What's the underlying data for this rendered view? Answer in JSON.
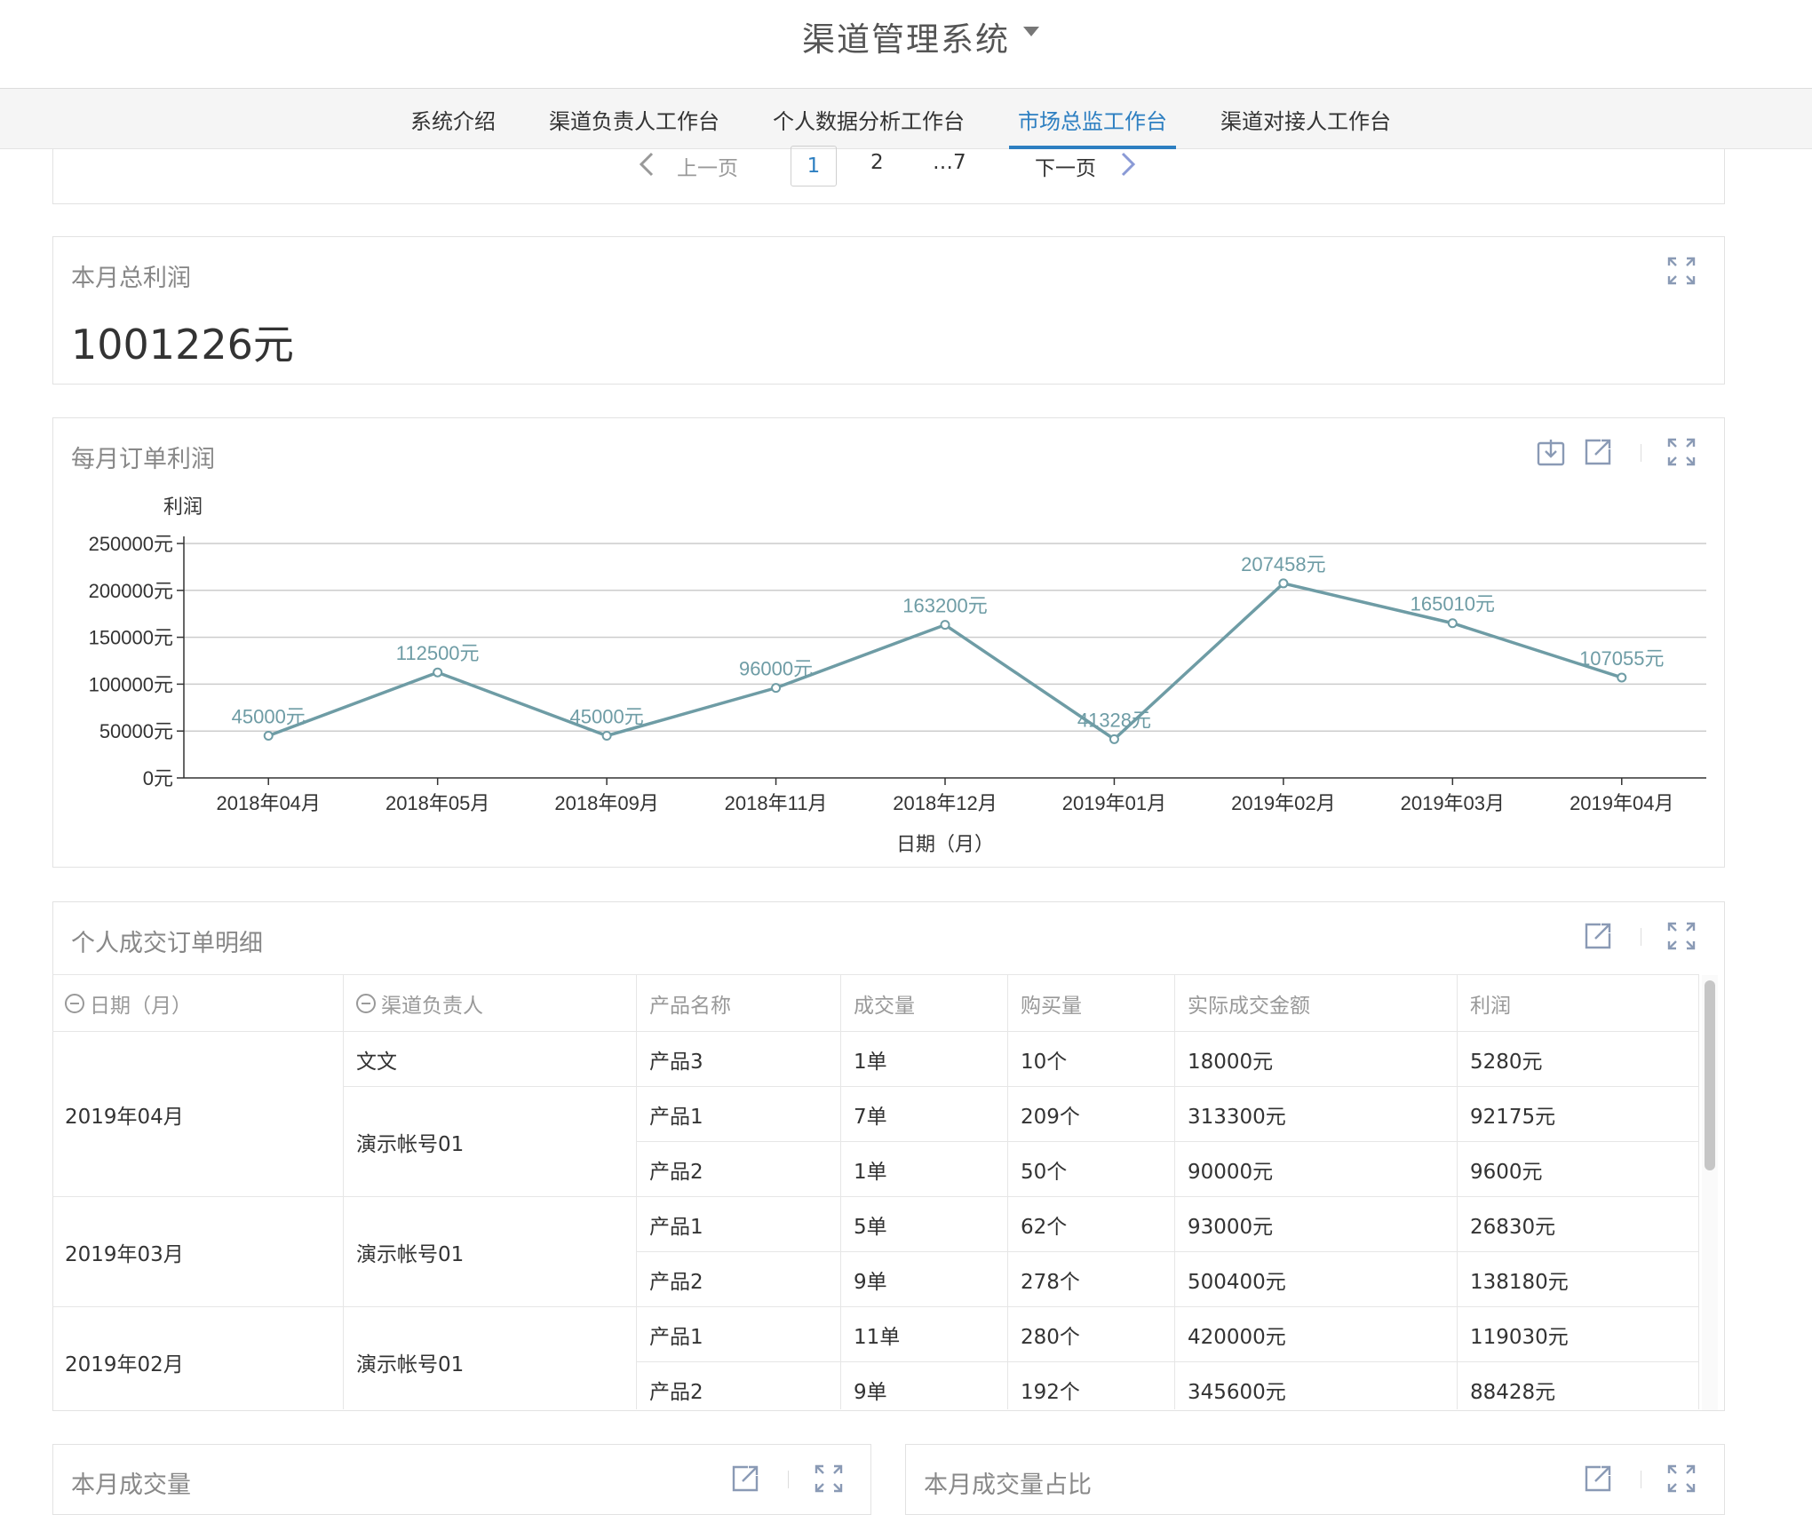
{
  "app": {
    "title": "渠道管理系统"
  },
  "nav": {
    "tabs": [
      {
        "label": "系统介绍"
      },
      {
        "label": "渠道负责人工作台"
      },
      {
        "label": "个人数据分析工作台"
      },
      {
        "label": "市场总监工作台"
      },
      {
        "label": "渠道对接人工作台"
      }
    ],
    "active": "市场总监工作台"
  },
  "pagination": {
    "prev": "上一页",
    "current": "1",
    "page2": "2",
    "ellipsis": "…7",
    "next": "下一页"
  },
  "profit_card": {
    "title": "本月总利润",
    "value": "1001226元"
  },
  "chart_card": {
    "title": "每月订单利润"
  },
  "chart_data": {
    "type": "line",
    "title": "",
    "ylabel": "利润",
    "xlabel": "日期（月）",
    "ylim": [
      0,
      250000
    ],
    "yticks": [
      "0元",
      "50000元",
      "100000元",
      "150000元",
      "200000元",
      "250000元"
    ],
    "categories": [
      "2018年04月",
      "2018年05月",
      "2018年09月",
      "2018年11月",
      "2018年12月",
      "2019年01月",
      "2019年02月",
      "2019年03月",
      "2019年04月"
    ],
    "values": [
      45000,
      112500,
      45000,
      96000,
      163200,
      41328,
      207458,
      165010,
      107055
    ],
    "data_labels": [
      "45000元",
      "112500元",
      "45000元",
      "96000元",
      "163200元",
      "41328元",
      "207458元",
      "165010元",
      "107055元"
    ],
    "grid": true,
    "line_color": "#6e9ca5"
  },
  "table_card": {
    "title": "个人成交订单明细",
    "headers": [
      "日期（月）",
      "渠道负责人",
      "产品名称",
      "成交量",
      "购买量",
      "实际成交金额",
      "利润"
    ],
    "groups": [
      {
        "date": "2019年04月",
        "owners": [
          {
            "name": "文文",
            "rows": [
              [
                "产品3",
                "1单",
                "10个",
                "18000元",
                "5280元"
              ]
            ]
          },
          {
            "name": "演示帐号01",
            "rows": [
              [
                "产品1",
                "7单",
                "209个",
                "313300元",
                "92175元"
              ],
              [
                "产品2",
                "1单",
                "50个",
                "90000元",
                "9600元"
              ]
            ]
          }
        ]
      },
      {
        "date": "2019年03月",
        "owners": [
          {
            "name": "演示帐号01",
            "rows": [
              [
                "产品1",
                "5单",
                "62个",
                "93000元",
                "26830元"
              ],
              [
                "产品2",
                "9单",
                "278个",
                "500400元",
                "138180元"
              ]
            ]
          }
        ]
      },
      {
        "date": "2019年02月",
        "owners": [
          {
            "name": "演示帐号01",
            "rows": [
              [
                "产品1",
                "11单",
                "280个",
                "420000元",
                "119030元"
              ],
              [
                "产品2",
                "9单",
                "192个",
                "345600元",
                "88428元"
              ]
            ]
          }
        ]
      }
    ]
  },
  "bottom_cards": {
    "left_title": "本月成交量",
    "right_title": "本月成交量占比"
  },
  "colors": {
    "accent": "#2d7fc1",
    "icon": "#8a9ab5",
    "line": "#6e9ca5"
  }
}
